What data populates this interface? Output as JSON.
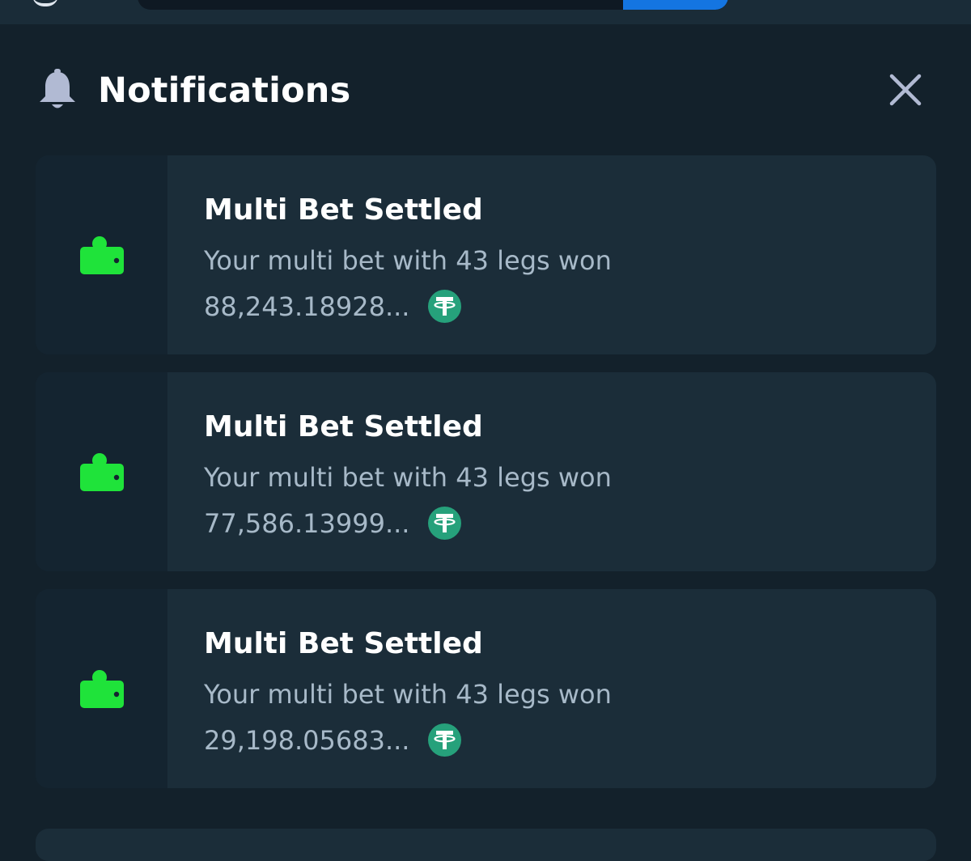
{
  "header": {
    "title": "Notifications",
    "bell_icon": "bell-icon",
    "close_icon": "close-icon"
  },
  "colors": {
    "background": "#13212b",
    "card": "#1b2d39",
    "accent_green": "#1fe33a",
    "usdt_green": "#26a17b",
    "search_button": "#1475e1"
  },
  "notifications": [
    {
      "icon": "wallet-icon",
      "title": "Multi Bet Settled",
      "message": "Your multi bet with 43 legs won",
      "amount": "88,243.18928...",
      "currency_icon": "usdt-icon"
    },
    {
      "icon": "wallet-icon",
      "title": "Multi Bet Settled",
      "message": "Your multi bet with 43 legs won",
      "amount": "77,586.13999...",
      "currency_icon": "usdt-icon"
    },
    {
      "icon": "wallet-icon",
      "title": "Multi Bet Settled",
      "message": "Your multi bet with 43 legs won",
      "amount": "29,198.05683...",
      "currency_icon": "usdt-icon"
    }
  ]
}
